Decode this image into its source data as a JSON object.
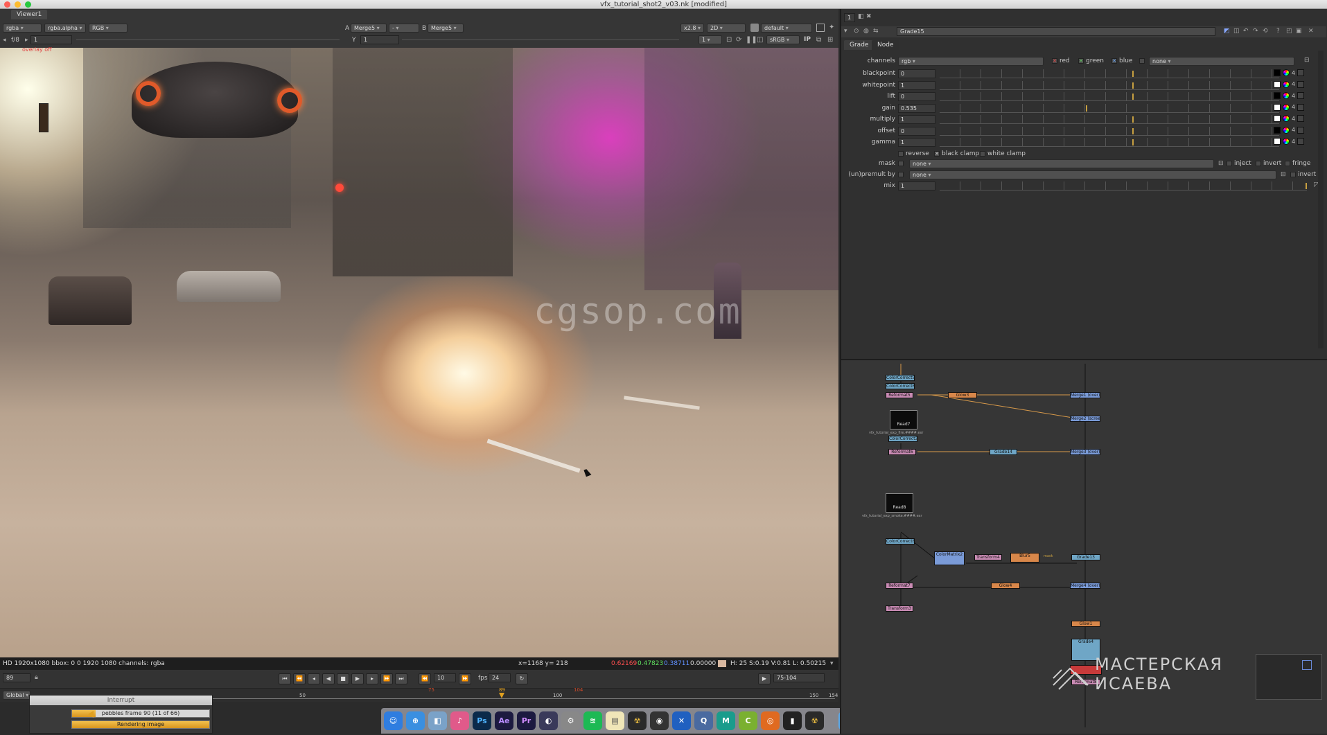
{
  "window": {
    "title": "vfx_tutorial_shot2_v03.nk [modified]"
  },
  "viewer": {
    "tab": "Viewer1",
    "channels": "rgba",
    "alpha": "rgba.alpha",
    "display": "RGB",
    "input_a_label": "A",
    "input_a": "Merge5",
    "compare_mode": "-",
    "input_b_label": "B",
    "input_b": "Merge5",
    "zoom": "x2.8",
    "view_mode": "2D",
    "lut_default": "default",
    "fstop": "f/8",
    "frame_field": "1",
    "y_label": "Y",
    "y_field": "1",
    "downrez": "1",
    "colorspace": "sRGB",
    "ip_label": "IP",
    "overlay": "overlay off",
    "watermark": "cgsop.com"
  },
  "infobar": {
    "format": "HD 1920x1080 bbox: 0 0 1920 1080 channels: rgba",
    "coords": "x=1168 y= 218",
    "r": "0.62169",
    "g": "0.47823",
    "b": "0.38711",
    "a": "0.00000",
    "hsv": "H: 25 S:0.19 V:0.81  L: 0.50215"
  },
  "transport": {
    "current_frame": "89",
    "step": "10",
    "fps_label": "fps",
    "fps": "24",
    "range": "75-104"
  },
  "timeline": {
    "scope": "Global",
    "ticks": [
      "50",
      "75",
      "89",
      "100",
      "104",
      "150",
      "154"
    ]
  },
  "interrupt": {
    "title": "Interrupt",
    "task1": "pebbles frame 90 (11 of 66)",
    "task1_progress": 0.17,
    "task2": "Rendering image",
    "task2_progress": 1.0
  },
  "properties": {
    "node_name": "Grade15",
    "tabs": [
      "Grade",
      "Node"
    ],
    "channels_label": "channels",
    "channels_value": "rgb",
    "red": "red",
    "green": "green",
    "blue": "blue",
    "extra_channel": "none",
    "params": [
      {
        "label": "blackpoint",
        "value": "0",
        "knob": 0.58
      },
      {
        "label": "whitepoint",
        "value": "1",
        "knob": 0.58
      },
      {
        "label": "lift",
        "value": "0",
        "knob": 0.58
      },
      {
        "label": "gain",
        "value": "0.535",
        "knob": 0.44
      },
      {
        "label": "multiply",
        "value": "1",
        "knob": 0.58
      },
      {
        "label": "offset",
        "value": "0",
        "knob": 0.58
      },
      {
        "label": "gamma",
        "value": "1",
        "knob": 0.58
      }
    ],
    "param_btn": "4",
    "reverse": "reverse",
    "black_clamp": "black clamp",
    "white_clamp": "white clamp",
    "mask_label": "mask",
    "mask_value": "none",
    "inject": "inject",
    "invert": "invert",
    "fringe": "fringe",
    "premult_label": "(un)premult by",
    "premult_value": "none",
    "premult_invert": "invert",
    "mix_label": "mix",
    "mix_value": "1",
    "panel_count": "1"
  },
  "nodegraph": {
    "nodes": [
      {
        "label": "ColorCorrect5",
        "cls": "n-cyan"
      },
      {
        "label": "ColorCorrect6",
        "cls": "n-cyan"
      },
      {
        "label": "Reformat5",
        "cls": "n-pink"
      },
      {
        "label": "Glow3",
        "cls": "n-orange"
      },
      {
        "label": "Merge1 (over)",
        "cls": "n-blue"
      },
      {
        "label": "Merge2 (screen)",
        "cls": "n-blue"
      },
      {
        "label": "ColorCorrect3",
        "cls": "n-cyan"
      },
      {
        "label": "Reformat6",
        "cls": "n-pink"
      },
      {
        "label": "Grade14",
        "cls": "n-cyan"
      },
      {
        "label": "Merge3 (over)",
        "cls": "n-blue"
      },
      {
        "label": "ColorCorrect8",
        "cls": "n-cyan"
      },
      {
        "label": "ColorMatrix2",
        "cls": "n-blue"
      },
      {
        "label": "Transform4",
        "cls": "n-pink"
      },
      {
        "label": "Blur5",
        "cls": "n-orange"
      },
      {
        "label": "Grade13",
        "cls": "n-cyan"
      },
      {
        "label": "Reformat7",
        "cls": "n-pink"
      },
      {
        "label": "Glow4",
        "cls": "n-orange"
      },
      {
        "label": "Merge4 (over)",
        "cls": "n-blue"
      },
      {
        "label": "Transform3",
        "cls": "n-pink"
      },
      {
        "label": "Glow1",
        "cls": "n-orange"
      },
      {
        "label": "Grade4",
        "cls": "n-cyan"
      },
      {
        "label": "Reformat8",
        "cls": "n-pink"
      }
    ],
    "thumb1": "Read7",
    "thumb1_file": "vfx_tutorial_exp_fire.####.exr",
    "thumb2": "Read8",
    "thumb2_file": "vfx_tutorial_exp_smoke.####.exr",
    "blur_mask_label": "mask"
  },
  "branding": {
    "line1": "МАСТЕРСКАЯ",
    "line2": "ИСАЕВА"
  },
  "colors": {
    "knob": "#c8a040",
    "red_value": "#ff5050",
    "green_value": "#60e060",
    "blue_value": "#6090ff"
  }
}
